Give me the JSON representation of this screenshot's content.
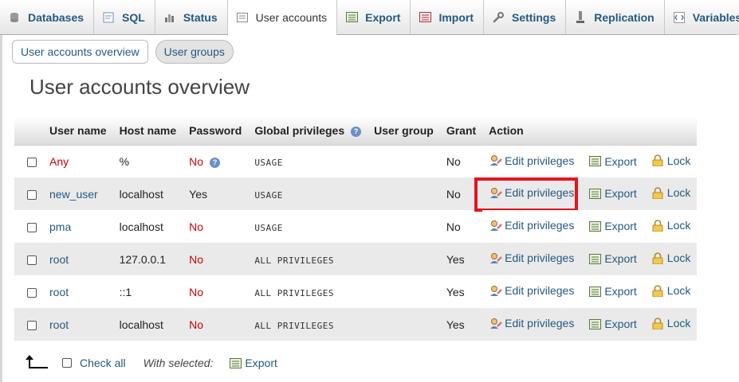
{
  "tabs": [
    {
      "label": "Databases",
      "icon": "database-icon"
    },
    {
      "label": "SQL",
      "icon": "sql-icon"
    },
    {
      "label": "Status",
      "icon": "status-icon"
    },
    {
      "label": "User accounts",
      "icon": "user-accounts-icon",
      "active": true
    },
    {
      "label": "Export",
      "icon": "export-icon"
    },
    {
      "label": "Import",
      "icon": "import-icon"
    },
    {
      "label": "Settings",
      "icon": "wrench-icon"
    },
    {
      "label": "Replication",
      "icon": "replication-icon"
    },
    {
      "label": "Variables",
      "icon": "variables-icon"
    }
  ],
  "subnav": {
    "overview": "User accounts overview",
    "groups": "User groups"
  },
  "page_title": "User accounts overview",
  "table": {
    "headers": {
      "user": "User name",
      "host": "Host name",
      "password": "Password",
      "global": "Global privileges",
      "group": "User group",
      "grant": "Grant",
      "action": "Action"
    },
    "rows": [
      {
        "user": "Any",
        "host": "%",
        "password": "No",
        "privileges": "USAGE",
        "group": "",
        "grant": "No"
      },
      {
        "user": "new_user",
        "host": "localhost",
        "password": "Yes",
        "privileges": "USAGE",
        "group": "",
        "grant": "No"
      },
      {
        "user": "pma",
        "host": "localhost",
        "password": "No",
        "privileges": "USAGE",
        "group": "",
        "grant": "No"
      },
      {
        "user": "root",
        "host": "127.0.0.1",
        "password": "No",
        "privileges": "ALL PRIVILEGES",
        "group": "",
        "grant": "Yes"
      },
      {
        "user": "root",
        "host": "::1",
        "password": "No",
        "privileges": "ALL PRIVILEGES",
        "group": "",
        "grant": "Yes"
      },
      {
        "user": "root",
        "host": "localhost",
        "password": "No",
        "privileges": "ALL PRIVILEGES",
        "group": "",
        "grant": "Yes"
      }
    ],
    "actions": {
      "edit": "Edit privileges",
      "export": "Export",
      "lock": "Lock"
    }
  },
  "footer": {
    "check_all": "Check all",
    "with_selected": "With selected:",
    "export": "Export"
  },
  "colors": {
    "link": "#235a81",
    "no_password": "#cc0000",
    "highlight_box": "#e8131d"
  }
}
